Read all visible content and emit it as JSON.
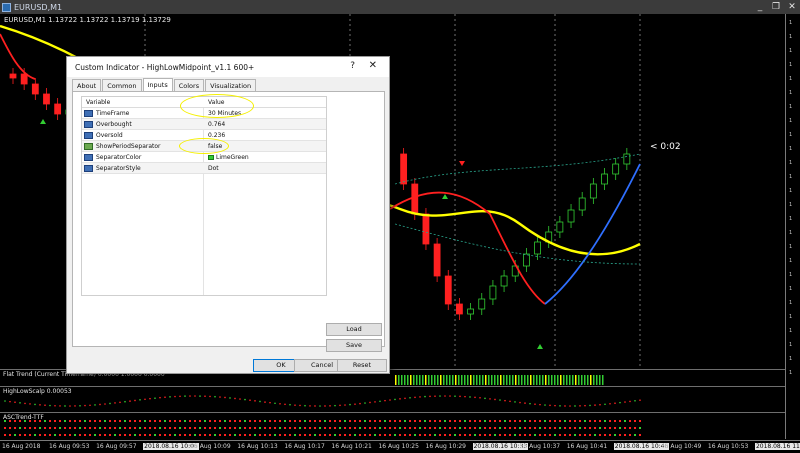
{
  "window": {
    "title": "EURUSD,M1",
    "btn_min": "_",
    "btn_restore": "❐",
    "btn_close": "✕"
  },
  "chart": {
    "title": "EURUSD,M1  1.13722 1.13722 1.13719 1.13729",
    "price_tag": "< 0:02",
    "colors": {
      "bull": "#32cd32",
      "bear": "#ff2020",
      "mid_line": "#ffff00",
      "trend_up": "#2f6fff",
      "trend_dn": "#ff2020",
      "bands": "#2aa78e"
    }
  },
  "subwindows": [
    {
      "title": "Flat Trend (Current Timeframe) 0.0000 1.0000 0.0000"
    },
    {
      "title": "HighLowScalp 0.00053"
    },
    {
      "title": "ASCTrend-TTF"
    }
  ],
  "time_axis": [
    {
      "label": "16 Aug 2018",
      "hl": false
    },
    {
      "label": "16 Aug 09:53",
      "hl": false
    },
    {
      "label": "16 Aug 09:57",
      "hl": false
    },
    {
      "label": "2018.08.16 10:06",
      "hl": true
    },
    {
      "label": "16 Aug 10:09",
      "hl": false
    },
    {
      "label": "16 Aug 10:13",
      "hl": false
    },
    {
      "label": "16 Aug 10:17",
      "hl": false
    },
    {
      "label": "16 Aug 10:21",
      "hl": false
    },
    {
      "label": "16 Aug 10:25",
      "hl": false
    },
    {
      "label": "16 Aug 10:29",
      "hl": false
    },
    {
      "label": "2018.08.16 10:33",
      "hl": true
    },
    {
      "label": "16 Aug 10:37",
      "hl": false
    },
    {
      "label": "16 Aug 10:41",
      "hl": false
    },
    {
      "label": "2018.08.16 10:46",
      "hl": true
    },
    {
      "label": "16 Aug 10:49",
      "hl": false
    },
    {
      "label": "16 Aug 10:53",
      "hl": false
    },
    {
      "label": "2018.08.16 11:02",
      "hl": true
    }
  ],
  "dialog": {
    "title": "Custom Indicator - HighLowMidpoint_v1.1 600+",
    "help": "?",
    "close": "✕",
    "tabs": [
      {
        "label": "About",
        "active": false
      },
      {
        "label": "Common",
        "active": false
      },
      {
        "label": "Inputs",
        "active": true
      },
      {
        "label": "Colors",
        "active": false
      },
      {
        "label": "Visualization",
        "active": false
      }
    ],
    "grid": {
      "col_variable": "Variable",
      "col_value": "Value",
      "rows": [
        {
          "name": "TimeFrame",
          "value": "30 Minutes",
          "type": "int"
        },
        {
          "name": "Overbought",
          "value": "0.764",
          "type": "int"
        },
        {
          "name": "Oversold",
          "value": "0.236",
          "type": "int"
        },
        {
          "name": "ShowPeriodSeparator",
          "value": "false",
          "type": "bool"
        },
        {
          "name": "SeparatorColor",
          "value": "LimeGreen",
          "type": "int",
          "swatch": "#32cd32"
        },
        {
          "name": "SeparatorStyle",
          "value": "Dot",
          "type": "int"
        }
      ]
    },
    "buttons": {
      "load": "Load",
      "save": "Save",
      "ok": "OK",
      "cancel": "Cancel",
      "reset": "Reset"
    }
  }
}
